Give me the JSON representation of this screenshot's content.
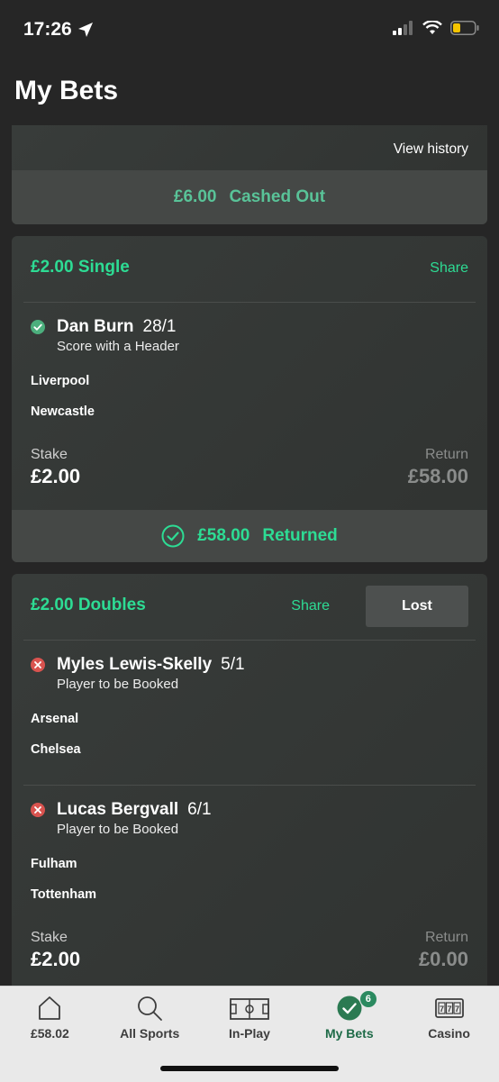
{
  "status": {
    "time": "17:26"
  },
  "page": {
    "title": "My Bets"
  },
  "card1": {
    "view_history": "View history",
    "cash_amount": "£6.00",
    "cash_label": "Cashed Out"
  },
  "card2": {
    "bet_type": "£2.00 Single",
    "share": "Share",
    "selection": {
      "name": "Dan Burn",
      "odds": "28/1",
      "market": "Score with a Header",
      "home": "Liverpool",
      "away": "Newcastle"
    },
    "stake_label": "Stake",
    "stake": "£2.00",
    "return_label": "Return",
    "return": "£58.00",
    "returned_amount": "£58.00",
    "returned_label": "Returned"
  },
  "card3": {
    "bet_type": "£2.00 Doubles",
    "share": "Share",
    "status": "Lost",
    "selections": [
      {
        "name": "Myles Lewis-Skelly",
        "odds": "5/1",
        "market": "Player to be Booked",
        "home": "Arsenal",
        "away": "Chelsea"
      },
      {
        "name": "Lucas Bergvall",
        "odds": "6/1",
        "market": "Player to be Booked",
        "home": "Fulham",
        "away": "Tottenham"
      }
    ],
    "stake_label": "Stake",
    "stake": "£2.00",
    "return_label": "Return",
    "return": "£0.00"
  },
  "tabbar": {
    "items": [
      {
        "label": "£58.02",
        "icon": "home-icon"
      },
      {
        "label": "All Sports",
        "icon": "search-icon"
      },
      {
        "label": "In-Play",
        "icon": "pitch-icon"
      },
      {
        "label": "My Bets",
        "icon": "check-circle-icon",
        "badge": "6",
        "active": true
      },
      {
        "label": "Casino",
        "icon": "slot-machine-icon"
      }
    ]
  },
  "colors": {
    "accent": "#2ddc94",
    "cashed": "#59c398",
    "won": "#4caf7d",
    "lost": "#d9534f"
  }
}
